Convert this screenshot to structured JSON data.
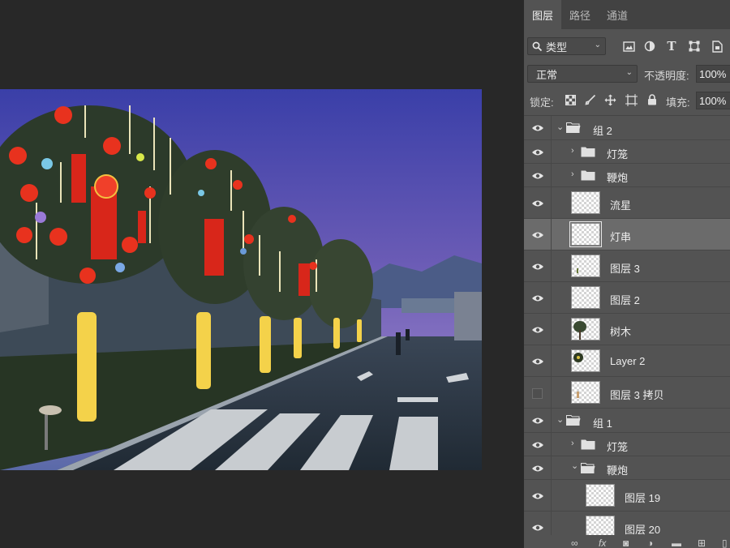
{
  "panel": {
    "tabs": [
      {
        "label": "图层",
        "active": true
      },
      {
        "label": "路径",
        "active": false
      },
      {
        "label": "通道",
        "active": false
      }
    ],
    "filter": {
      "label": "类型"
    },
    "filter_icons": [
      "image-filter-icon",
      "adjustment-filter-icon",
      "type-filter-icon",
      "shape-filter-icon",
      "smart-object-filter-icon"
    ],
    "blend_mode": "正常",
    "opacity_label": "不透明度:",
    "opacity_value": "100%",
    "lock_label": "锁定:",
    "fill_label": "填充:",
    "fill_value": "100%",
    "layers": [
      {
        "name": "组 2",
        "type": "group",
        "expanded": true,
        "visible": true,
        "level": 0
      },
      {
        "name": "灯笼",
        "type": "group",
        "expanded": false,
        "visible": true,
        "level": 1
      },
      {
        "name": "鞭炮",
        "type": "group",
        "expanded": false,
        "visible": true,
        "level": 1
      },
      {
        "name": "流星",
        "type": "layer",
        "visible": true,
        "level": 1
      },
      {
        "name": "灯串",
        "type": "layer",
        "visible": true,
        "level": 1,
        "selected": true
      },
      {
        "name": "图层 3",
        "type": "layer",
        "visible": true,
        "level": 1
      },
      {
        "name": "图层 2",
        "type": "layer",
        "visible": true,
        "level": 1
      },
      {
        "name": "树木",
        "type": "layer",
        "visible": true,
        "level": 1
      },
      {
        "name": "Layer 2",
        "type": "layer",
        "visible": true,
        "level": 1
      },
      {
        "name": "图层 3 拷贝",
        "type": "layer",
        "visible": false,
        "level": 1
      },
      {
        "name": "组 1",
        "type": "group",
        "expanded": true,
        "visible": true,
        "level": 0
      },
      {
        "name": "灯笼",
        "type": "group",
        "expanded": false,
        "visible": true,
        "level": 1
      },
      {
        "name": "鞭炮",
        "type": "group",
        "expanded": true,
        "visible": true,
        "level": 1
      },
      {
        "name": "图层 19",
        "type": "layer",
        "visible": true,
        "level": 2
      },
      {
        "name": "图层 20",
        "type": "layer",
        "visible": true,
        "level": 2
      }
    ],
    "footer_icons": [
      "link-icon",
      "fx-icon",
      "mask-icon",
      "adjustment-icon",
      "new-group-icon",
      "new-layer-icon",
      "delete-icon"
    ]
  }
}
